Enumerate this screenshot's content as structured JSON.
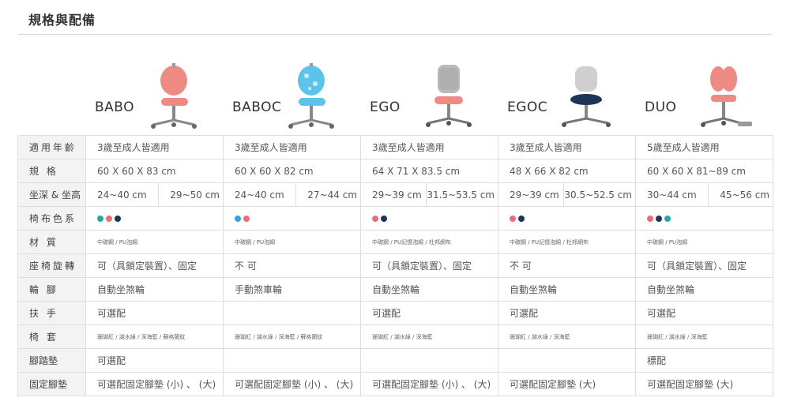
{
  "page": {
    "title": "規格與配備"
  },
  "products": [
    {
      "name": "BABO"
    },
    {
      "name": "BABOC"
    },
    {
      "name": "EGO"
    },
    {
      "name": "EGOC"
    },
    {
      "name": "DUO"
    }
  ],
  "rows": {
    "age": {
      "label": "適用年齡",
      "values": [
        "3歲至成人皆適用",
        "3歲至成人皆適用",
        "3歲至成人皆適用",
        "3歲至成人皆適用",
        "5歲至成人皆適用"
      ]
    },
    "size": {
      "label": "規 格",
      "values": [
        "60 X 60 X 83 cm",
        "60 X 60 X 82 cm",
        "64 X 71 X 83.5 cm",
        "48 X 66 X 82 cm",
        "60 X 60 X 81~89 cm"
      ]
    },
    "depth_height": {
      "label": "坐深 & 坐高",
      "values": [
        [
          "24~40 cm",
          "29~50 cm"
        ],
        [
          "24~40 cm",
          "27~44 cm"
        ],
        [
          "29~39 cm",
          "31.5~53.5 cm"
        ],
        [
          "29~39 cm",
          "30.5~52.5 cm"
        ],
        [
          "30~44 cm",
          "45~56 cm"
        ]
      ]
    },
    "colors": {
      "label": "椅布色系",
      "swatches": [
        [
          "#2aa8a0",
          "#e8707a",
          "#1e3557"
        ],
        [
          "#3aa3d8",
          "#e8707a"
        ],
        [
          "#e8707a",
          "#1e3557"
        ],
        [
          "#e8707a",
          "#1e3557"
        ],
        [
          "#e8707a",
          "#1e3557",
          "#2aa8a0"
        ]
      ]
    },
    "material": {
      "label": "材 質",
      "values": [
        "中碳鋼 / PU泡綿",
        "中碳鋼 / PU泡綿",
        "中碳鋼 / PU記憶泡綿 / 杜邦網布",
        "中碳鋼 / PU記憶泡綿 / 杜邦網布",
        "中碳鋼 / PU泡綿"
      ]
    },
    "swivel": {
      "label": "座椅旋轉",
      "values": [
        "可（具鎖定裝置）、固定",
        "不 可",
        "可（具鎖定裝置）、固定",
        "不 可",
        "可（具鎖定裝置）、固定"
      ]
    },
    "wheels": {
      "label": "輪 腳",
      "values": [
        "自動坐煞輪",
        "手動煞車輪",
        "自動坐煞輪",
        "自動坐煞輪",
        "自動坐煞輪"
      ]
    },
    "armrest": {
      "label": "扶 手",
      "values": [
        "可選配",
        "",
        "可選配",
        "可選配",
        "可選配"
      ]
    },
    "cover": {
      "label": "椅 套",
      "values": [
        "珊瑚紅 / 湖水綠 / 深海藍 / 蘇格蘭紋",
        "珊瑚紅 / 湖水綠 / 深海藍 / 蘇格蘭紋",
        "珊瑚紅 / 湖水綠 / 深海藍",
        "珊瑚紅 / 湖水綠 / 深海藍",
        "珊瑚紅 / 湖水綠 / 深海藍"
      ]
    },
    "footrest": {
      "label": "腳踏墊",
      "values": [
        "可選配",
        "",
        "",
        "",
        "標配"
      ]
    },
    "fixed_pad": {
      "label": "固定腳墊",
      "values": [
        "可選配固定腳墊 (小) 、 (大)",
        "可選配固定腳墊 (小) 、 (大)",
        "可選配固定腳墊 (小) 、 (大)",
        "可選配固定腳墊 (大)",
        "可選配固定腳墊 (大)"
      ]
    }
  }
}
